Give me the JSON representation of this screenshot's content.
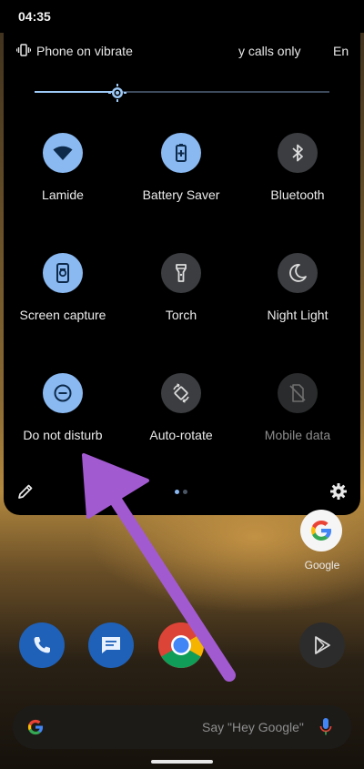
{
  "status_bar": {
    "time": "04:35"
  },
  "shade_header": {
    "vibrate_text": "Phone on vibrate",
    "calls_text": "y calls only",
    "en_text": "En"
  },
  "brightness": {
    "level": 0.28
  },
  "tiles": [
    {
      "label": "Lamide",
      "state": "on",
      "icon": "wifi-icon"
    },
    {
      "label": "Battery Saver",
      "state": "on",
      "icon": "battery-saver-icon"
    },
    {
      "label": "Bluetooth",
      "state": "off",
      "icon": "bluetooth-icon"
    },
    {
      "label": "Screen capture",
      "state": "on",
      "icon": "screen-capture-icon"
    },
    {
      "label": "Torch",
      "state": "off",
      "icon": "torch-icon"
    },
    {
      "label": "Night Light",
      "state": "off",
      "icon": "moon-icon"
    },
    {
      "label": "Do not disturb",
      "state": "on",
      "icon": "do-not-disturb-icon"
    },
    {
      "label": "Auto-rotate",
      "state": "off",
      "icon": "auto-rotate-icon"
    },
    {
      "label": "Mobile data",
      "state": "unavailable",
      "icon": "mobile-data-off-icon"
    }
  ],
  "shade_footer": {
    "page_count": 2,
    "current_page": 1
  },
  "home": {
    "google_app_label": "Google",
    "dock": [
      {
        "name": "phone",
        "icon": "phone-icon",
        "color": "#1f61b8"
      },
      {
        "name": "messages",
        "icon": "messages-icon",
        "color": "#1f61b8"
      },
      {
        "name": "chrome",
        "icon": "chrome-icon",
        "color": "#d43a2c"
      },
      {
        "name": "play-store",
        "icon": "play-store-icon",
        "color": "#2a2a2a"
      }
    ],
    "search_hint": "Say \"Hey Google\""
  },
  "colors": {
    "tile_on": "#8ab9f1",
    "tile_off": "#3b3d40",
    "arrow": "#a25ad1",
    "slider_fill": "#9dc9f7"
  }
}
